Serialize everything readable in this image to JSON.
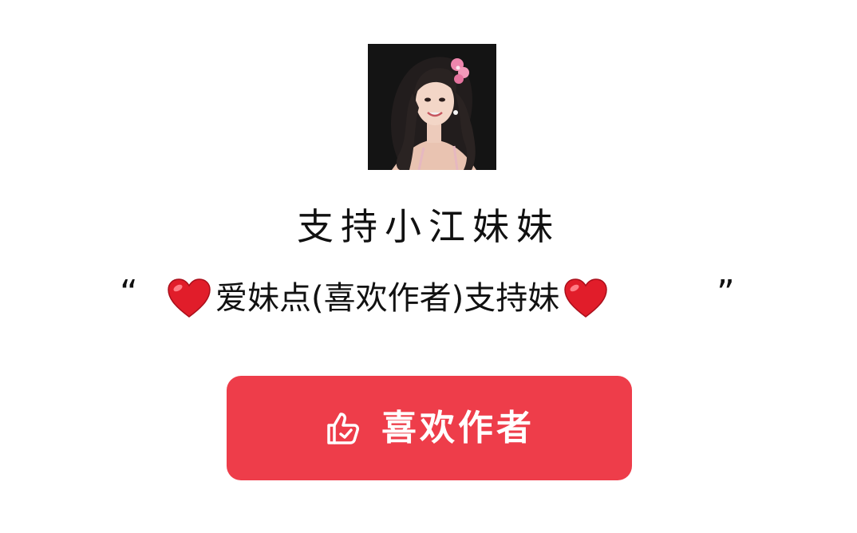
{
  "avatar": {
    "icon": "woman-portrait",
    "background": "#141414"
  },
  "title": "支持小江妹妹",
  "message": {
    "open_quote": "“",
    "text": "爱妹点(喜欢作者)支持妹",
    "close_quote": "”",
    "icon": "heart-emoji"
  },
  "like_button": {
    "label": "喜欢作者",
    "icon": "thumbs-up-icon",
    "color": "#ee3d4a"
  }
}
